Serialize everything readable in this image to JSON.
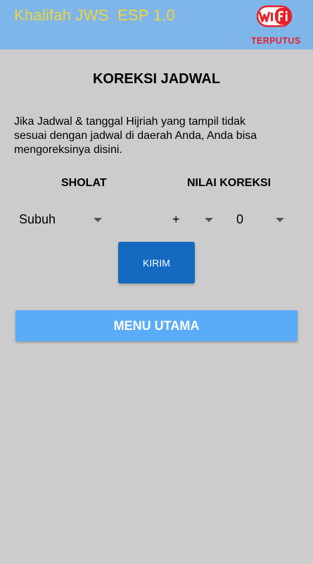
{
  "header": {
    "title": "Khalifah JWS  ESP 1.0",
    "wifi_label": "Wi Fi",
    "connection_status": "TERPUTUS"
  },
  "page": {
    "title": "KOREKSI JADWAL",
    "description": "Jika Jadwal & tanggal Hijriah yang tampil tidak\nsesuai dengan jadwal di daerah Anda, Anda bisa\nmengoreksinya  disini."
  },
  "form": {
    "sholat_header": "SHOLAT",
    "nilai_header": "NILAI KOREKSI",
    "sholat_selected": "Subuh",
    "sign_selected": "+",
    "value_selected": "0"
  },
  "buttons": {
    "kirim": "KIRIM",
    "menu_utama": "MENU UTAMA"
  },
  "colors": {
    "header_bg": "#7fb6ea",
    "title_yellow": "#f2d43a",
    "status_red": "#e5212b",
    "kirim_bg": "#1469c1",
    "menu_bg": "#5aacf8",
    "page_bg": "#cccccc"
  }
}
